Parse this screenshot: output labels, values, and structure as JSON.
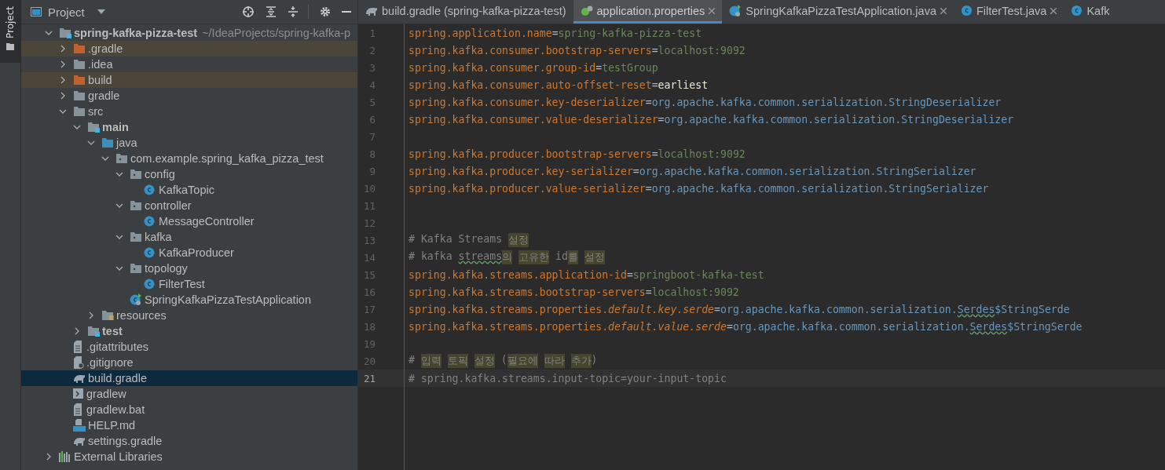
{
  "side_stripe": {
    "label": "Project"
  },
  "project_panel": {
    "title": "Project"
  },
  "tree": [
    {
      "name": "spring-kafka-pizza-test",
      "path": "~/IdeaProjects/spring-kafka-p",
      "kind": "module-root",
      "expanded": true,
      "selected": false,
      "children": [
        {
          "name": ".gradle",
          "kind": "excluded-folder",
          "expanded": false,
          "selected": false
        },
        {
          "name": ".idea",
          "kind": "folder",
          "expanded": false,
          "selected": false
        },
        {
          "name": "build",
          "kind": "excluded-folder",
          "expanded": false,
          "selected": false
        },
        {
          "name": "gradle",
          "kind": "folder",
          "expanded": false,
          "selected": false
        },
        {
          "name": "src",
          "kind": "folder",
          "expanded": true,
          "selected": false,
          "children": [
            {
              "name": "main",
              "kind": "module-folder",
              "expanded": true,
              "selected": false,
              "children": [
                {
                  "name": "java",
                  "kind": "source-folder",
                  "expanded": true,
                  "selected": false,
                  "children": [
                    {
                      "name": "com.example.spring_kafka_pizza_test",
                      "kind": "package",
                      "expanded": true,
                      "selected": false,
                      "children": [
                        {
                          "name": "config",
                          "kind": "package",
                          "expanded": true,
                          "selected": false,
                          "children": [
                            {
                              "name": "KafkaTopic",
                              "kind": "class",
                              "selected": false
                            }
                          ]
                        },
                        {
                          "name": "controller",
                          "kind": "package",
                          "expanded": true,
                          "selected": false,
                          "children": [
                            {
                              "name": "MessageController",
                              "kind": "class",
                              "selected": false
                            }
                          ]
                        },
                        {
                          "name": "kafka",
                          "kind": "package",
                          "expanded": true,
                          "selected": false,
                          "children": [
                            {
                              "name": "KafkaProducer",
                              "kind": "class",
                              "selected": false
                            }
                          ]
                        },
                        {
                          "name": "topology",
                          "kind": "package",
                          "expanded": true,
                          "selected": false,
                          "children": [
                            {
                              "name": "FilterTest",
                              "kind": "class",
                              "selected": false
                            }
                          ]
                        },
                        {
                          "name": "SpringKafkaPizzaTestApplication",
                          "kind": "spring-class",
                          "selected": false
                        }
                      ]
                    }
                  ]
                },
                {
                  "name": "resources",
                  "kind": "resources-folder",
                  "expanded": false,
                  "selected": false
                }
              ]
            },
            {
              "name": "test",
              "kind": "module-folder",
              "expanded": false,
              "selected": false
            }
          ]
        },
        {
          "name": ".gitattributes",
          "kind": "text-file",
          "selected": false
        },
        {
          "name": ".gitignore",
          "kind": "ignore-file",
          "selected": false
        },
        {
          "name": "build.gradle",
          "kind": "gradle-file",
          "selected": true
        },
        {
          "name": "gradlew",
          "kind": "shell-file",
          "selected": false
        },
        {
          "name": "gradlew.bat",
          "kind": "text-file",
          "selected": false
        },
        {
          "name": "HELP.md",
          "kind": "markdown-file",
          "selected": false
        },
        {
          "name": "settings.gradle",
          "kind": "gradle-file",
          "selected": false
        }
      ]
    },
    {
      "name": "External Libraries",
      "kind": "libraries",
      "expanded": false,
      "selected": false
    }
  ],
  "tabs": [
    {
      "label": "build.gradle (spring-kafka-pizza-test)",
      "kind": "gradle-file",
      "selected": false,
      "closable": false
    },
    {
      "label": "application.properties",
      "kind": "properties-file",
      "selected": true,
      "closable": true
    },
    {
      "label": "SpringKafkaPizzaTestApplication.java",
      "kind": "spring-class",
      "selected": false,
      "closable": true
    },
    {
      "label": "FilterTest.java",
      "kind": "class",
      "selected": false,
      "closable": true
    },
    {
      "label": "Kafk",
      "kind": "class",
      "selected": false,
      "closable": false
    }
  ],
  "editor": {
    "lines": [
      {
        "number": "1",
        "tokens": [
          {
            "kind": "key",
            "text": "spring.application.name"
          },
          {
            "kind": "op",
            "text": "="
          },
          {
            "kind": "value",
            "text": "spring-kafka-pizza-test"
          }
        ]
      },
      {
        "number": "2",
        "tokens": [
          {
            "kind": "key",
            "text": "spring.kafka.consumer.bootstrap-servers"
          },
          {
            "kind": "op",
            "text": "="
          },
          {
            "kind": "value",
            "text": "localhost:9092"
          }
        ]
      },
      {
        "number": "3",
        "tokens": [
          {
            "kind": "key",
            "text": "spring.kafka.consumer.group-id"
          },
          {
            "kind": "op",
            "text": "="
          },
          {
            "kind": "value",
            "text": "testGroup"
          }
        ]
      },
      {
        "number": "4",
        "tokens": [
          {
            "kind": "key",
            "text": "spring.kafka.consumer.auto-offset-reset"
          },
          {
            "kind": "op",
            "text": "="
          },
          {
            "kind": "keyword",
            "text": "earliest"
          }
        ]
      },
      {
        "number": "5",
        "tokens": [
          {
            "kind": "key",
            "text": "spring.kafka.consumer.key-deserializer"
          },
          {
            "kind": "op",
            "text": "="
          },
          {
            "kind": "class",
            "text": "org.apache.kafka.common.serialization.StringDeserializer"
          }
        ]
      },
      {
        "number": "6",
        "tokens": [
          {
            "kind": "key",
            "text": "spring.kafka.consumer.value-deserializer"
          },
          {
            "kind": "op",
            "text": "="
          },
          {
            "kind": "class",
            "text": "org.apache.kafka.common.serialization.StringDeserializer"
          }
        ]
      },
      {
        "number": "7"
      },
      {
        "number": "8",
        "tokens": [
          {
            "kind": "key",
            "text": "spring.kafka.producer.bootstrap-servers"
          },
          {
            "kind": "op",
            "text": "="
          },
          {
            "kind": "value",
            "text": "localhost:9092"
          }
        ]
      },
      {
        "number": "9",
        "tokens": [
          {
            "kind": "key",
            "text": "spring.kafka.producer.key-serializer"
          },
          {
            "kind": "op",
            "text": "="
          },
          {
            "kind": "class",
            "text": "org.apache.kafka.common.serialization.StringSerializer"
          }
        ]
      },
      {
        "number": "10",
        "tokens": [
          {
            "kind": "key",
            "text": "spring.kafka.producer.value-serializer"
          },
          {
            "kind": "op",
            "text": "="
          },
          {
            "kind": "class",
            "text": "org.apache.kafka.common.serialization.StringSerializer"
          }
        ]
      },
      {
        "number": "11"
      },
      {
        "number": "12"
      },
      {
        "number": "13",
        "tokens": [
          {
            "kind": "comment",
            "text": "# Kafka Streams "
          },
          {
            "kind": "highlight",
            "text": "설정"
          }
        ]
      },
      {
        "number": "14",
        "tokens": [
          {
            "kind": "comment",
            "text": "# kafka "
          },
          {
            "kind": "typo",
            "text": "streams"
          },
          {
            "kind": "highlight",
            "text": "의"
          },
          {
            "kind": "highlight",
            "text": "고유한",
            "spaced": true
          },
          {
            "kind": "comment",
            "text": " id"
          },
          {
            "kind": "highlight",
            "text": "를"
          },
          {
            "kind": "highlight",
            "text": "설정",
            "spaced": true
          }
        ]
      },
      {
        "number": "15",
        "tokens": [
          {
            "kind": "key",
            "text": "spring.kafka.streams.application-id"
          },
          {
            "kind": "op",
            "text": "="
          },
          {
            "kind": "value",
            "text": "springboot-kafka-test"
          }
        ]
      },
      {
        "number": "16",
        "tokens": [
          {
            "kind": "key",
            "text": "spring.kafka.streams.bootstrap-servers"
          },
          {
            "kind": "op",
            "text": "="
          },
          {
            "kind": "value",
            "text": "localhost:9092"
          }
        ]
      },
      {
        "number": "17",
        "tokens": [
          {
            "kind": "key",
            "text": "spring.kafka.streams.properties."
          },
          {
            "kind": "italic-key",
            "text": "default.key.serde"
          },
          {
            "kind": "op",
            "text": "="
          },
          {
            "kind": "class",
            "text": "org.apache.kafka.common.serialization."
          },
          {
            "kind": "class-typo",
            "text": "Serdes"
          },
          {
            "kind": "class",
            "text": "$StringSerde"
          }
        ]
      },
      {
        "number": "18",
        "tokens": [
          {
            "kind": "key",
            "text": "spring.kafka.streams.properties."
          },
          {
            "kind": "italic-key",
            "text": "default.value.serde"
          },
          {
            "kind": "op",
            "text": "="
          },
          {
            "kind": "class",
            "text": "org.apache.kafka.common.serialization."
          },
          {
            "kind": "class-typo",
            "text": "Serdes"
          },
          {
            "kind": "class",
            "text": "$StringSerde"
          }
        ]
      },
      {
        "number": "19"
      },
      {
        "number": "20",
        "tokens": [
          {
            "kind": "comment",
            "text": "# "
          },
          {
            "kind": "highlight",
            "text": "입력"
          },
          {
            "kind": "highlight",
            "text": "토픽",
            "spaced": true
          },
          {
            "kind": "highlight",
            "text": "설정",
            "spaced": true
          },
          {
            "kind": "comment",
            "text": " ("
          },
          {
            "kind": "highlight",
            "text": "필요에"
          },
          {
            "kind": "highlight",
            "text": "따라",
            "spaced": true
          },
          {
            "kind": "highlight",
            "text": "추가",
            "spaced": true
          },
          {
            "kind": "comment",
            "text": ")"
          }
        ]
      },
      {
        "number": "21",
        "current": true,
        "tokens": [
          {
            "kind": "comment",
            "text": "# spring.kafka.streams.input-topic=your-input-topic"
          }
        ]
      }
    ]
  }
}
